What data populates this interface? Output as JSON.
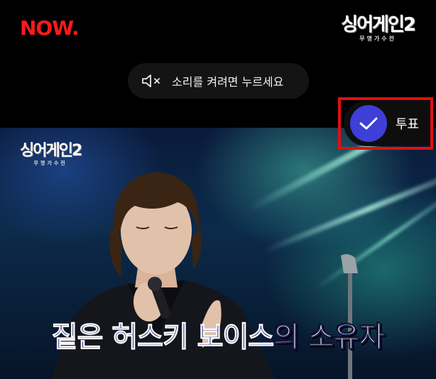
{
  "header": {
    "service_logo": "NOW.",
    "show_logo": {
      "main": "싱어게인2",
      "sub": "무명가수전"
    }
  },
  "unmute_prompt": {
    "icon": "speaker-muted-icon",
    "label": "소리를 켜려면 누르세요"
  },
  "vote": {
    "icon": "check-icon",
    "label": "투표",
    "accent_color": "#3d3fd6",
    "highlight_color": "#e01010"
  },
  "video": {
    "show_logo": {
      "main": "싱어게인2",
      "sub": "무명가수전"
    },
    "subtitle": {
      "part1": "짙은 허스키 보이스",
      "part2": "의 소유자"
    }
  },
  "colors": {
    "background": "#000000",
    "brand_red": "#ff1a1a",
    "pill_bg": "#141414"
  }
}
